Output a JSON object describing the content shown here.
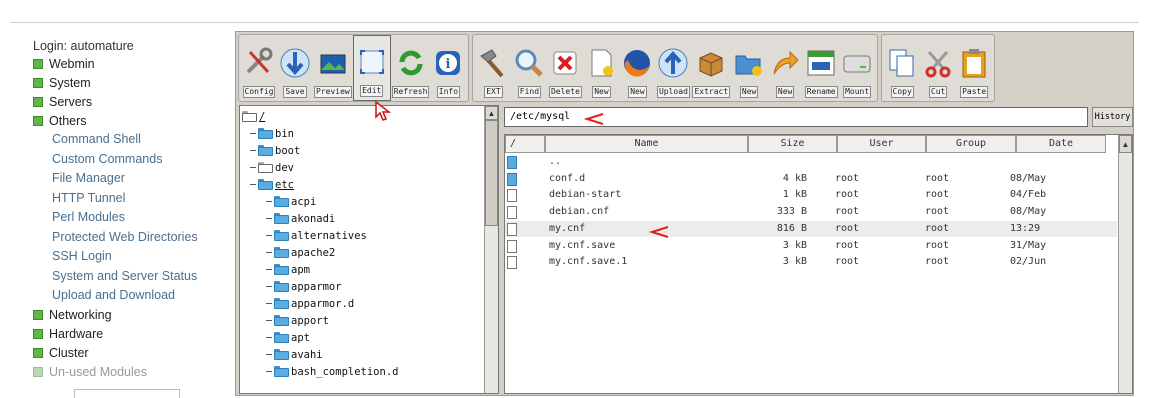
{
  "sidebar": {
    "login": "Login: automature",
    "categories_top": [
      {
        "label": "Webmin"
      },
      {
        "label": "System"
      },
      {
        "label": "Servers"
      },
      {
        "label": "Others"
      }
    ],
    "modules": [
      "Command Shell",
      "Custom Commands",
      "File Manager",
      "HTTP Tunnel",
      "Perl Modules",
      "Protected Web Directories",
      "SSH Login",
      "System and Server Status",
      "Upload and Download"
    ],
    "categories_bottom": [
      {
        "label": "Networking"
      },
      {
        "label": "Hardware"
      },
      {
        "label": "Cluster"
      },
      {
        "label": "Un-used Modules"
      }
    ]
  },
  "toolbar": {
    "groups": [
      [
        {
          "label": "Config",
          "icon": "tools-icon"
        },
        {
          "label": "Save",
          "icon": "download-arrow-icon"
        },
        {
          "label": "Preview",
          "icon": "image-preview-icon"
        },
        {
          "label": "Edit",
          "icon": "edit-frame-icon"
        },
        {
          "label": "Refresh",
          "icon": "refresh-icon"
        },
        {
          "label": "Info",
          "icon": "info-icon"
        }
      ],
      [
        {
          "label": "EXT",
          "icon": "hammer-icon"
        },
        {
          "label": "Find",
          "icon": "magnifier-icon"
        },
        {
          "label": "Delete",
          "icon": "delete-icon"
        },
        {
          "label": "New",
          "icon": "new-file-icon"
        },
        {
          "label": "New",
          "icon": "firefox-icon"
        },
        {
          "label": "Upload",
          "icon": "upload-arrow-icon"
        },
        {
          "label": "Extract",
          "icon": "box-icon"
        },
        {
          "label": "New",
          "icon": "new-folder-icon"
        },
        {
          "label": "New",
          "icon": "link-arrow-icon"
        },
        {
          "label": "Rename",
          "icon": "rename-icon"
        },
        {
          "label": "Mount",
          "icon": "drive-icon"
        }
      ],
      [
        {
          "label": "Copy",
          "icon": "copy-icon"
        },
        {
          "label": "Cut",
          "icon": "scissors-icon"
        },
        {
          "label": "Paste",
          "icon": "clipboard-icon"
        }
      ]
    ]
  },
  "tree": {
    "root": "/",
    "top_dirs": [
      "bin",
      "boot",
      "dev",
      "etc"
    ],
    "etc_children": [
      "acpi",
      "akonadi",
      "alternatives",
      "apache2",
      "apm",
      "apparmor",
      "apparmor.d",
      "apport",
      "apt",
      "avahi",
      "bash_completion.d"
    ]
  },
  "path": {
    "value": "/etc/mysql",
    "history_label": "History"
  },
  "filelist": {
    "headers": {
      "sort": "/",
      "name": "Name",
      "size": "Size",
      "user": "User",
      "group": "Group",
      "date": "Date"
    },
    "rows": [
      {
        "type": "dir",
        "name": "..",
        "size": "",
        "user": "",
        "group": "",
        "date": ""
      },
      {
        "type": "dir",
        "name": "conf.d",
        "size": "4 kB",
        "user": "root",
        "group": "root",
        "date": "08/May"
      },
      {
        "type": "file",
        "name": "debian-start",
        "size": "1 kB",
        "user": "root",
        "group": "root",
        "date": "04/Feb"
      },
      {
        "type": "file",
        "name": "debian.cnf",
        "size": "333 B",
        "user": "root",
        "group": "root",
        "date": "08/May"
      },
      {
        "type": "file",
        "name": "my.cnf",
        "size": "816 B",
        "user": "root",
        "group": "root",
        "date": "13:29",
        "selected": true
      },
      {
        "type": "file",
        "name": "my.cnf.save",
        "size": "3 kB",
        "user": "root",
        "group": "root",
        "date": "31/May"
      },
      {
        "type": "file",
        "name": "my.cnf.save.1",
        "size": "3 kB",
        "user": "root",
        "group": "root",
        "date": "02/Jun"
      }
    ]
  },
  "colors": {
    "accent_link": "#4a6f8f",
    "category_green": "#5fb84a",
    "annotation_red": "#e02020",
    "window_gray": "#d4d0c8"
  }
}
